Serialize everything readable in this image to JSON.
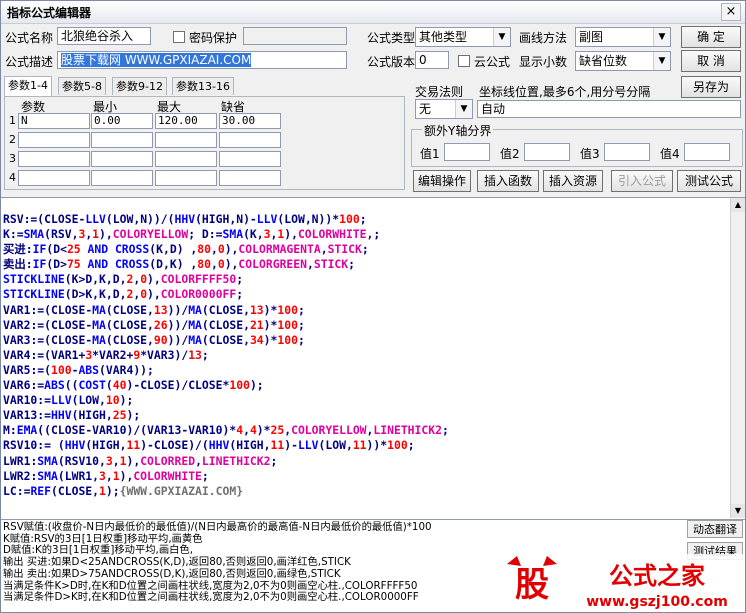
{
  "window": {
    "title": "指标公式编辑器",
    "close_glyph": "×"
  },
  "form": {
    "name_label": "公式名称",
    "name_value": "北狼绝谷杀入",
    "password_label": "密码保护",
    "desc_label": "公式描述",
    "desc_value": "股票下载网 WWW.GPXIAZAI.COM",
    "type_label": "公式类型",
    "type_value": "其他类型",
    "draw_label": "画线方法",
    "draw_value": "副图",
    "version_label": "公式版本",
    "version_value": "0",
    "cloud_label": "云公式",
    "decimal_label": "显示小数",
    "decimal_value": "缺省位数",
    "trade_label": "交易法则",
    "trade_value": "无",
    "coord_label": "坐标线位置,最多6个,用分号分隔",
    "coord_value": "自动",
    "extra_axis_label": "额外Y轴分界",
    "axis_labels": [
      "值1",
      "值2",
      "值3",
      "值4"
    ]
  },
  "buttons": {
    "ok": "确  定",
    "cancel": "取  消",
    "save_as": "另存为",
    "edit": "编辑操作",
    "insert_func": "插入函数",
    "insert_res": "插入资源",
    "import": "引入公式",
    "test": "测试公式",
    "dyn_translate": "动态翻译",
    "test_result": "测试结果"
  },
  "tabs": [
    "参数1-4",
    "参数5-8",
    "参数9-12",
    "参数13-16"
  ],
  "params": {
    "headers": [
      "参数",
      "最小",
      "最大",
      "缺省"
    ],
    "rows": [
      {
        "idx": "1",
        "name": "N",
        "min": "0.00",
        "max": "120.00",
        "def": "30.00"
      },
      {
        "idx": "2",
        "name": "",
        "min": "",
        "max": "",
        "def": ""
      },
      {
        "idx": "3",
        "name": "",
        "min": "",
        "max": "",
        "def": ""
      },
      {
        "idx": "4",
        "name": "",
        "min": "",
        "max": "",
        "def": ""
      }
    ]
  },
  "code_lines": [
    "RSV:=(CLOSE-LLV(LOW,N))/(HHV(HIGH,N)-LLV(LOW,N))*100;",
    "K:=SMA(RSV,3,1),COLORYELLOW; D:=SMA(K,3,1),COLORWHITE,;",
    "买进:IF(D<25 AND CROSS(K,D) ,80,0),COLORMAGENTA,STICK;",
    "卖出:IF(D>75 AND CROSS(D,K) ,80,0),COLORGREEN,STICK;",
    "STICKLINE(K>D,K,D,2,0),COLORFFFF50;",
    "STICKLINE(D>K,K,D,2,0),COLOR0000FF;",
    "VAR1:=(CLOSE-MA(CLOSE,13))/MA(CLOSE,13)*100;",
    "VAR2:=(CLOSE-MA(CLOSE,26))/MA(CLOSE,21)*100;",
    "VAR3:=(CLOSE-MA(CLOSE,90))/MA(CLOSE,34)*100;",
    "VAR4:=(VAR1+3*VAR2+9*VAR3)/13;",
    "VAR5:=(100-ABS(VAR4));",
    "VAR6:=ABS((COST(40)-CLOSE)/CLOSE*100);",
    "VAR10:=LLV(LOW,10);",
    "VAR13:=HHV(HIGH,25);",
    "M:EMA((CLOSE-VAR10)/(VAR13-VAR10)*4,4)*25,COLORYELLOW,LINETHICK2;",
    "RSV10:= (HHV(HIGH,11)-CLOSE)/(HHV(HIGH,11)-LLV(LOW,11))*100;",
    "LWR1:SMA(RSV10,3,1),COLORRED,LINETHICK2;",
    "LWR2:SMA(LWR1,3,1),COLORWHITE;",
    "LC:=REF(CLOSE,1);{WWW.GPXIAZAI.COM}"
  ],
  "description_lines": [
    "RSV赋值:(收盘价-N日内最低价的最低值)/(N日内最高价的最高值-N日内最低价的最低值)*100",
    "K赋值:RSV的3日[1日权重]移动平均,画黄色",
    "D赋值:K的3日[1日权重]移动平均,画白色,",
    "输出 买进:如果D<25ANDCROSS(K,D),返回80,否则返回0,画洋红色,STICK",
    "输出 卖出:如果D>75ANDCROSS(D,K),返回80,否则返回0,画绿色,STICK",
    "当满足条件K>D时,在K和D位置之间画柱状线,宽度为2,0不为0则画空心柱.,COLORFFFF50",
    "当满足条件D>K时,在K和D位置之间画柱状线,宽度为2,0不为0则画空心柱.,COLOR0000FF"
  ],
  "logo": {
    "char": "股",
    "text": "公式之家",
    "url": "www.gszj100.com"
  },
  "colors": {
    "keyword": "#000080",
    "number": "#ff0000",
    "function": "#0000ff",
    "color_const": "#e000a0",
    "comment": "#707070",
    "logo_red": "#e00000"
  }
}
